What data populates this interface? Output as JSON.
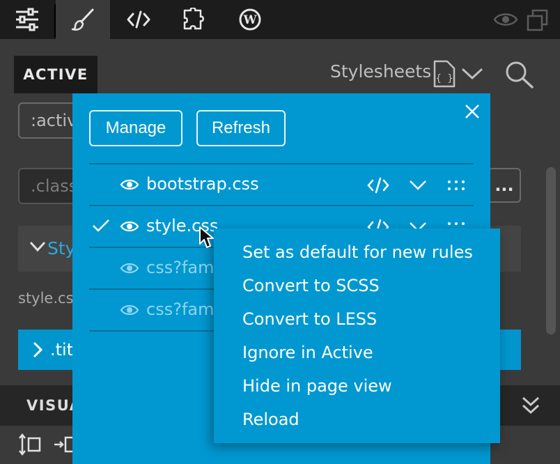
{
  "toolbar": {
    "tabs": [
      {
        "icon": "sliders-icon"
      },
      {
        "icon": "brush-icon",
        "active": true
      },
      {
        "icon": "code-icon"
      },
      {
        "icon": "puzzle-icon"
      },
      {
        "icon": "wordpress-icon"
      }
    ],
    "right_icons": [
      "eye-icon",
      "windows-icon"
    ]
  },
  "header": {
    "active_tab": "ACTIVE",
    "stylesheets_label": "Stylesheets"
  },
  "panel": {
    "selector_value": ":activ",
    "class_placeholder": ".class",
    "more_button": "...",
    "style_section": "Sty",
    "style_caption": "style.cs",
    "rule_label": ".tit",
    "visual_label": "VISUA"
  },
  "popup": {
    "manage_button": "Manage",
    "refresh_button": "Refresh",
    "stylesheets": [
      {
        "name": "bootstrap.css",
        "checked": false,
        "dim": false
      },
      {
        "name": "style.css",
        "checked": true,
        "dim": false
      },
      {
        "name": "css?fami",
        "checked": false,
        "dim": true
      },
      {
        "name": "css?fami",
        "checked": false,
        "dim": true
      }
    ]
  },
  "context_menu": {
    "items": [
      "Set as default for new rules",
      "Convert to SCSS",
      "Convert to LESS",
      "Ignore in Active",
      "Hide in page view",
      "Reload"
    ]
  },
  "colors": {
    "accent": "#0198d1",
    "toolbar_bg": "#1c1c1c",
    "panel_bg": "#3a3a3a",
    "link_blue": "#2ea8e0"
  }
}
